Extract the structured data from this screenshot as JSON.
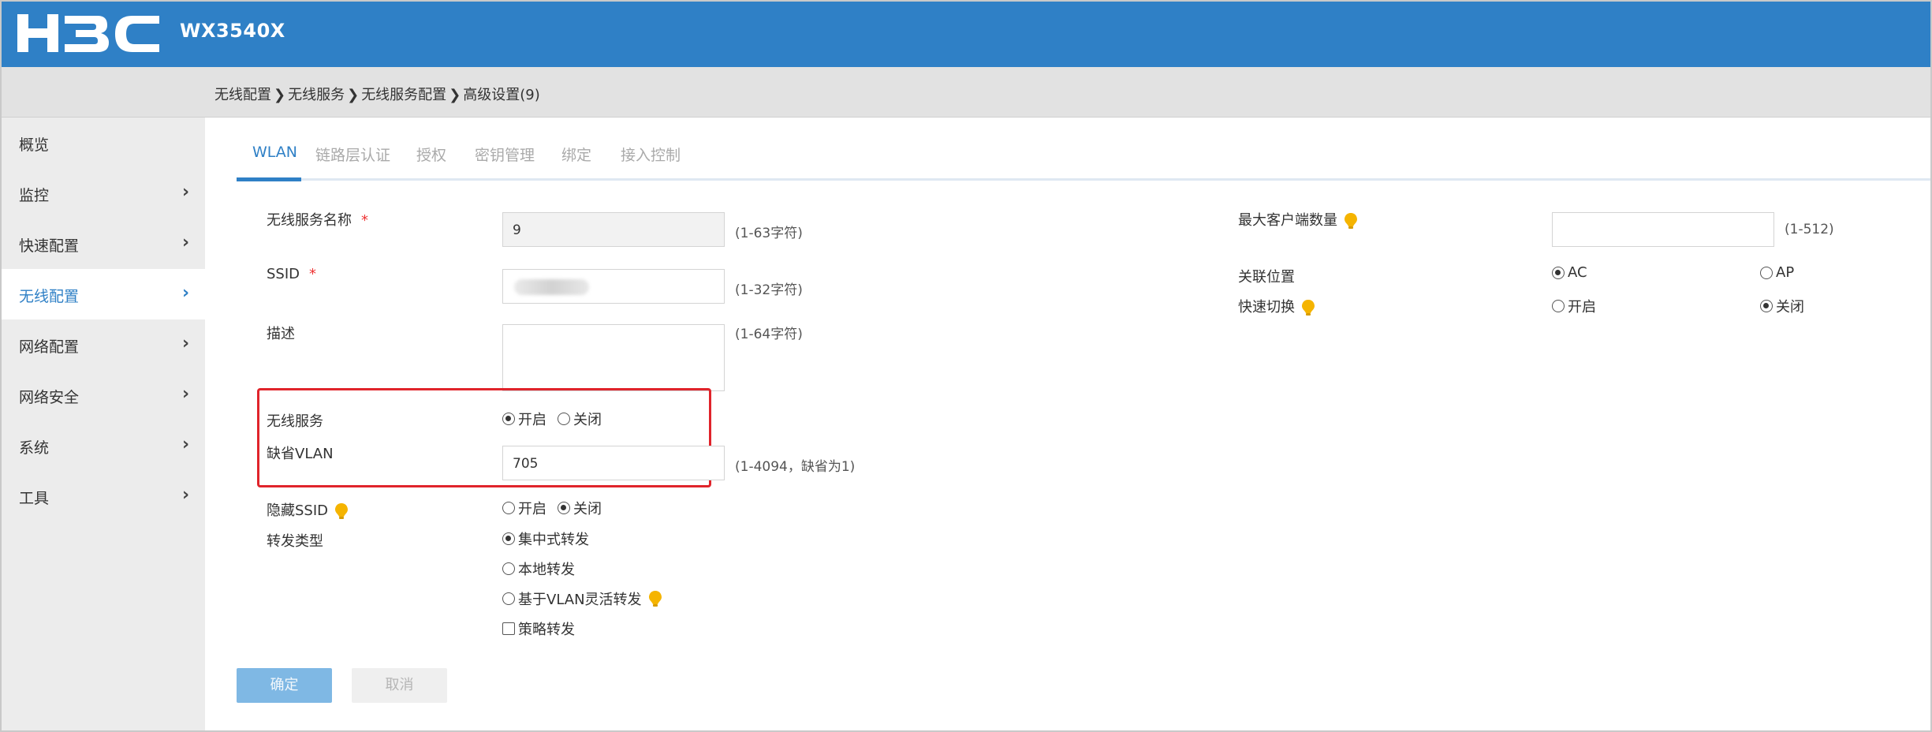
{
  "header": {
    "logo": "H3C",
    "model": "WX3540X",
    "color": "#2f80c6"
  },
  "breadcrumb": [
    "无线配置",
    "无线服务",
    "无线服务配置",
    "高级设置(9)"
  ],
  "breadcrumb_sep": "❯",
  "sidebar": {
    "items": [
      {
        "label": "概览",
        "chevron": ""
      },
      {
        "label": "监控",
        "chevron": "›"
      },
      {
        "label": "快速配置",
        "chevron": "›"
      },
      {
        "label": "无线配置",
        "chevron": "›",
        "active": true
      },
      {
        "label": "网络配置",
        "chevron": "›"
      },
      {
        "label": "网络安全",
        "chevron": "›"
      },
      {
        "label": "系统",
        "chevron": "›"
      },
      {
        "label": "工具",
        "chevron": "›"
      }
    ]
  },
  "tabs": [
    "WLAN",
    "链路层认证",
    "授权",
    "密钥管理",
    "绑定",
    "接入控制"
  ],
  "form": {
    "service_name": {
      "label": "无线服务名称",
      "required": "*",
      "value": "9",
      "hint": "(1-63字符)"
    },
    "ssid": {
      "label": "SSID",
      "required": "*",
      "value": "",
      "hint": "(1-32字符)"
    },
    "description": {
      "label": "描述",
      "hint": "(1-64字符)"
    },
    "wireless_service": {
      "label": "无线服务",
      "options": [
        "开启",
        "关闭"
      ],
      "selected": "开启"
    },
    "default_vlan": {
      "label": "缺省VLAN",
      "value": "705",
      "hint": "(1-4094，缺省为1)"
    },
    "hide_ssid": {
      "label": "隐藏SSID",
      "options": [
        "开启",
        "关闭"
      ],
      "selected": "关闭"
    },
    "forward_type": {
      "label": "转发类型",
      "options": [
        "集中式转发",
        "本地转发",
        "基于VLAN灵活转发"
      ],
      "selected": "集中式转发",
      "policy_forward": "策略转发"
    },
    "max_clients": {
      "label": "最大客户端数量",
      "value": "",
      "hint": "(1-512)"
    },
    "assoc_location": {
      "label": "关联位置",
      "options": [
        "AC",
        "AP"
      ],
      "selected": "AC"
    },
    "fast_roaming": {
      "label": "快速切换",
      "options": [
        "开启",
        "关闭"
      ],
      "selected": "关闭"
    }
  },
  "buttons": {
    "ok": "确定",
    "cancel": "取消"
  },
  "colors": {
    "accent": "#2f80c6",
    "highlight": "#e0242b",
    "tip": "#f5b400"
  }
}
